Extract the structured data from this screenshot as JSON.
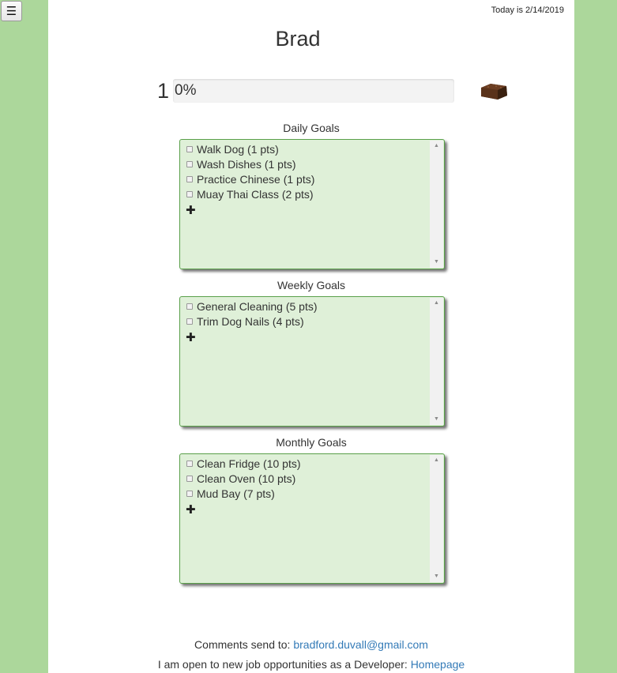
{
  "header": {
    "menu_icon": "hamburger-icon",
    "menu_glyph": "☰",
    "date_text": "Today is 2/14/2019"
  },
  "profile": {
    "name": "Brad",
    "level": "1",
    "progress_text": "0%",
    "progress_fraction": 0.0,
    "reward_icon": "brownie-icon"
  },
  "daily": {
    "title": "Daily Goals",
    "items": [
      "Walk Dog (1 pts)",
      "Wash Dishes (1 pts)",
      "Practice Chinese (1 pts)",
      "Muay Thai Class (2 pts)"
    ],
    "add_glyph": "✚"
  },
  "weekly": {
    "title": "Weekly Goals",
    "items": [
      "General Cleaning (5 pts)",
      "Trim Dog Nails (4 pts)"
    ],
    "add_glyph": "✚"
  },
  "monthly": {
    "title": "Monthly Goals",
    "items": [
      "Clean Fridge (10 pts)",
      "Clean Oven (10 pts)",
      "Mud Bay (7 pts)"
    ],
    "add_glyph": "✚"
  },
  "scroll": {
    "up_glyph": "▲",
    "down_glyph": "▼"
  },
  "footer": {
    "comments_prefix": "Comments send to: ",
    "email": "bradford.duvall@gmail.com",
    "jobs_prefix": "I am open to new job opportunities as a Developer: ",
    "homepage_label": "Homepage"
  },
  "colors": {
    "page_bg": "#acd79b",
    "goal_box_bg": "#dff0d8",
    "goal_box_border": "#5aa04a",
    "link": "#337ab7"
  }
}
